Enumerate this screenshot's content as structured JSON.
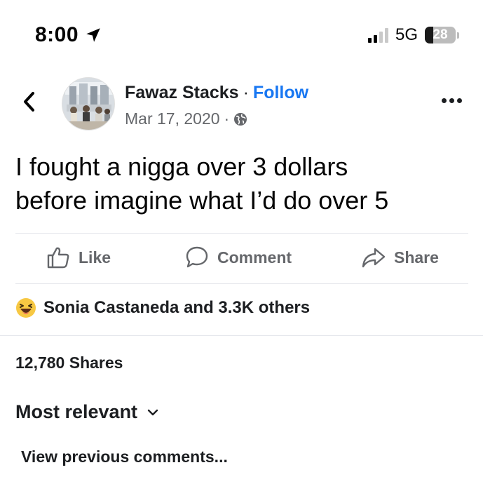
{
  "status_bar": {
    "time": "8:00",
    "network": "5G",
    "battery": "28",
    "battery_level": 0.28
  },
  "post": {
    "author": "Fawaz Stacks",
    "separator": "·",
    "follow_label": "Follow",
    "date": "Mar 17, 2020",
    "date_separator": "·",
    "text_line1": "I fought a nigga over 3 dollars",
    "text_line2": "before imagine what I’d do over 5"
  },
  "actions": {
    "like": "Like",
    "comment": "Comment",
    "share": "Share"
  },
  "reactions": {
    "summary": "Sonia Castaneda and 3.3K others"
  },
  "stats": {
    "shares": "12,780 Shares"
  },
  "comments": {
    "sort_label": "Most relevant",
    "view_previous": "View previous comments..."
  },
  "colors": {
    "accent": "#1877f2",
    "secondary_text": "#65676b",
    "divider": "#e4e6eb"
  },
  "icons": [
    "location-arrow-icon",
    "back-chevron-icon",
    "globe-icon",
    "more-icon",
    "like-icon",
    "comment-icon",
    "share-icon",
    "haha-reaction-icon",
    "chevron-down-icon"
  ]
}
